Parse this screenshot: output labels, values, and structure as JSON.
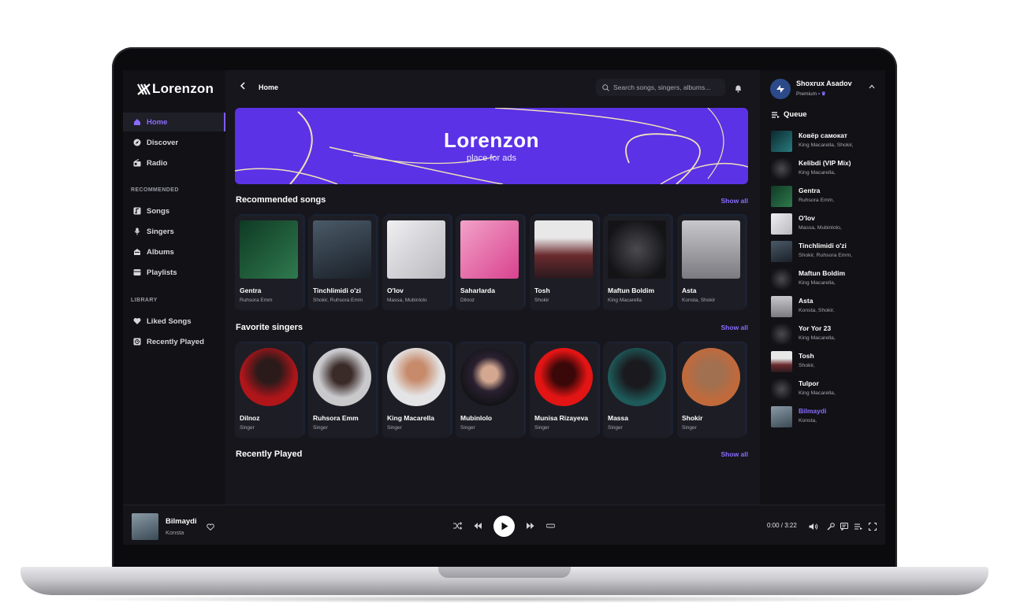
{
  "app": {
    "logo": "Lorenzon",
    "breadcrumb": "Home",
    "search_placeholder": "Search songs, singers, albums..."
  },
  "sidebar": {
    "main_items": [
      {
        "label": "Home",
        "icon": "home-icon",
        "active": true
      },
      {
        "label": "Discover",
        "icon": "compass-icon"
      },
      {
        "label": "Radio",
        "icon": "radio-icon"
      }
    ],
    "recommended_label": "RECOMMENDED",
    "recommended_items": [
      {
        "label": "Songs",
        "icon": "music-note-icon"
      },
      {
        "label": "Singers",
        "icon": "microphone-icon"
      },
      {
        "label": "Albums",
        "icon": "album-icon"
      },
      {
        "label": "Playlists",
        "icon": "playlist-icon"
      }
    ],
    "library_label": "LIBRARY",
    "library_items": [
      {
        "label": "Liked Songs",
        "icon": "heart-icon"
      },
      {
        "label": "Recently Played",
        "icon": "history-icon"
      }
    ]
  },
  "banner": {
    "title": "Lorenzon",
    "subtitle": "place for ads",
    "color": "#5b32e6"
  },
  "sections": {
    "recommended": {
      "title": "Recommended songs",
      "show_all": "Show all",
      "cards": [
        {
          "title": "Gentra",
          "subtitle": "Ruhsora Emm",
          "color": "#1f5a3a"
        },
        {
          "title": "Tinchlimidi o'zi",
          "subtitle": "Shokir, Ruhsora Emm",
          "color": "#26303a"
        },
        {
          "title": "O'lov",
          "subtitle": "Massa, Mubinlolo",
          "color": "#d9d9dd"
        },
        {
          "title": "Saharlarda",
          "subtitle": "Dilnoz",
          "color": "#d9428f"
        },
        {
          "title": "Tosh",
          "subtitle": "Shokir",
          "color": "#3a2a2e"
        },
        {
          "title": "Maftun Boldim",
          "subtitle": "King Macarella",
          "color": "#2a2a2e"
        },
        {
          "title": "Asta",
          "subtitle": "Konsta, Shokir",
          "color": "#9c9ca2"
        }
      ]
    },
    "singers": {
      "title": "Favorite singers",
      "show_all": "Show all",
      "cards": [
        {
          "title": "Dilnoz",
          "subtitle": "Singer",
          "color": "#b0151a"
        },
        {
          "title": "Ruhsora Emm",
          "subtitle": "Singer",
          "color": "#c9c9cc"
        },
        {
          "title": "King Macarella",
          "subtitle": "Singer",
          "color": "#e4e4e6"
        },
        {
          "title": "Mubinlolo",
          "subtitle": "Singer",
          "color": "#1f1f26"
        },
        {
          "title": "Munisa Rizayeva",
          "subtitle": "Singer",
          "color": "#e31414"
        },
        {
          "title": "Massa",
          "subtitle": "Singer",
          "color": "#1e5a5a"
        },
        {
          "title": "Shokir",
          "subtitle": "Singer",
          "color": "#c06a3c"
        }
      ]
    },
    "recent": {
      "title": "Recently Played",
      "show_all": "Show all",
      "cards": [
        {
          "color": "#15484c"
        },
        {
          "color": "#2a2a2e"
        },
        {
          "color": "#1f5a3a"
        },
        {
          "color": "#d9d9dd"
        },
        {
          "color": "#26303a"
        },
        {
          "color": "#2a2a2e"
        },
        {
          "color": "#9c9ca2"
        }
      ]
    }
  },
  "user": {
    "name": "Shoxrux Asadov",
    "plan": "Premium"
  },
  "queue": {
    "title": "Queue",
    "items": [
      {
        "title": "Ковёр самокат",
        "artist": "King Macarella, Shokir,",
        "color": "#15484c"
      },
      {
        "title": "Kelibdi (VIP Mix)",
        "artist": "King Macarella,",
        "color": "#2a2a2e"
      },
      {
        "title": "Gentra",
        "artist": "Ruhsora Emm,",
        "color": "#1f5a3a"
      },
      {
        "title": "O'lov",
        "artist": "Massa, Mubinlolo,",
        "color": "#d9d9dd"
      },
      {
        "title": "Tinchlimidi o'zi",
        "artist": "Shokir, Ruhsora Emm,",
        "color": "#26303a"
      },
      {
        "title": "Maftun Boldim",
        "artist": "King Macarella,",
        "color": "#2a2a2e"
      },
      {
        "title": "Asta",
        "artist": "Konsta, Shokir,",
        "color": "#9c9ca2"
      },
      {
        "title": "Yor Yor 23",
        "artist": "King Macarella,",
        "color": "#2a2a2e"
      },
      {
        "title": "Tosh",
        "artist": "Shokir,",
        "color": "#3a2a2e"
      },
      {
        "title": "Tulpor",
        "artist": "King Macarella,",
        "color": "#2a2a2e"
      },
      {
        "title": "Bilmaydi",
        "artist": "Konsta,",
        "color": "#5b6f7a",
        "playing": true
      }
    ]
  },
  "player": {
    "title": "Bilmaydi",
    "artist": "Konsta",
    "time": "0:00 / 3:22",
    "progress": 0
  },
  "accent_color": "#7b5cff"
}
